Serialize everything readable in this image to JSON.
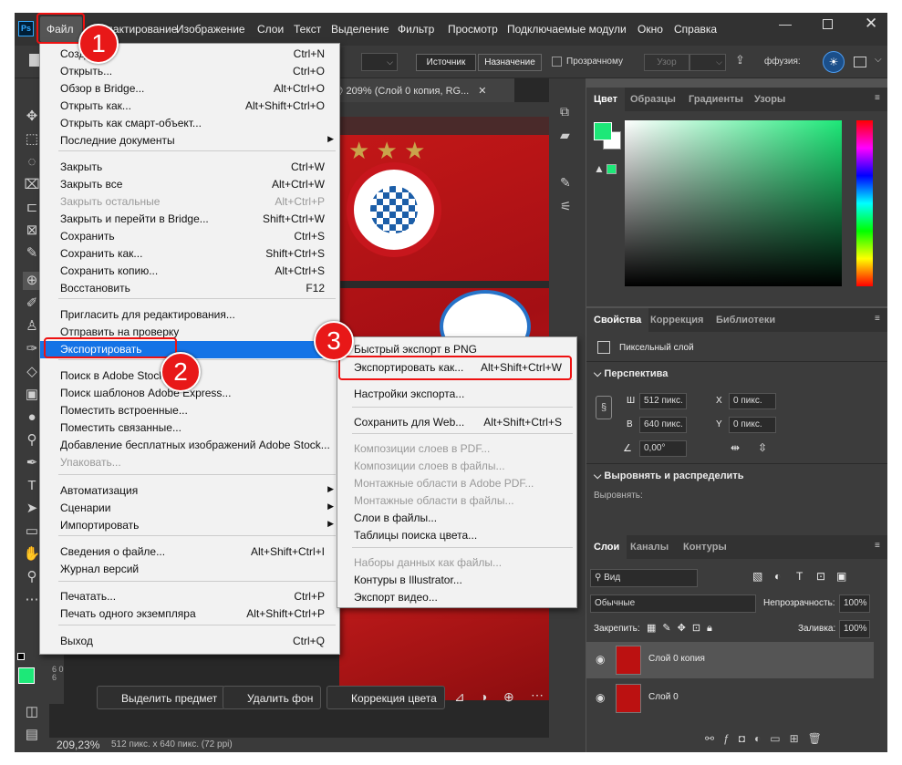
{
  "app": {
    "logo": "Ps"
  },
  "menubar": [
    "Файл",
    "Редактирование",
    "Изображение",
    "Слои",
    "Текст",
    "Выделение",
    "Фильтр",
    "Просмотр",
    "Подключаемые модули",
    "Окно",
    "Справка"
  ],
  "options": {
    "source": "Источник",
    "dest": "Назначение",
    "transparent": "Прозрачному",
    "pattern": "Узор",
    "zoom_field": "ффузия:"
  },
  "document": {
    "tab": "ng @ 209% (Слой 0 копия, RG...",
    "zoom": "209,23%",
    "info": "512 пикс. x 640 пикс. (72 ppi)",
    "ruler": "6 0 6"
  },
  "file_menu": {
    "items": [
      {
        "label": "Создать...",
        "shortcut": "Ctrl+N"
      },
      {
        "label": "Открыть...",
        "shortcut": "Ctrl+O"
      },
      {
        "label": "Обзор в Bridge...",
        "shortcut": "Alt+Ctrl+O"
      },
      {
        "label": "Открыть как...",
        "shortcut": "Alt+Shift+Ctrl+O"
      },
      {
        "label": "Открыть как смарт-объект...",
        "shortcut": ""
      },
      {
        "label": "Последние документы",
        "shortcut": ""
      },
      {
        "label": "Закрыть",
        "shortcut": "Ctrl+W"
      },
      {
        "label": "Закрыть все",
        "shortcut": "Alt+Ctrl+W"
      },
      {
        "label": "Закрыть остальные",
        "shortcut": "Alt+Ctrl+P"
      },
      {
        "label": "Закрыть и перейти в Bridge...",
        "shortcut": "Shift+Ctrl+W"
      },
      {
        "label": "Сохранить",
        "shortcut": "Ctrl+S"
      },
      {
        "label": "Сохранить как...",
        "shortcut": "Shift+Ctrl+S"
      },
      {
        "label": "Сохранить копию...",
        "shortcut": "Alt+Ctrl+S"
      },
      {
        "label": "Восстановить",
        "shortcut": "F12"
      },
      {
        "label": "Пригласить для редактирования...",
        "shortcut": ""
      },
      {
        "label": "Отправить на проверку",
        "shortcut": ""
      },
      {
        "label": "Экспортировать",
        "shortcut": ""
      },
      {
        "label": "Поиск в Adobe Stock...",
        "shortcut": ""
      },
      {
        "label": "Поиск шаблонов Adobe Express...",
        "shortcut": ""
      },
      {
        "label": "Поместить встроенные...",
        "shortcut": ""
      },
      {
        "label": "Поместить связанные...",
        "shortcut": ""
      },
      {
        "label": "Добавление бесплатных изображений Adobe Stock...",
        "shortcut": ""
      },
      {
        "label": "Упаковать...",
        "shortcut": ""
      },
      {
        "label": "Автоматизация",
        "shortcut": ""
      },
      {
        "label": "Сценарии",
        "shortcut": ""
      },
      {
        "label": "Импортировать",
        "shortcut": ""
      },
      {
        "label": "Сведения о файле...",
        "shortcut": "Alt+Shift+Ctrl+I"
      },
      {
        "label": "Журнал версий",
        "shortcut": ""
      },
      {
        "label": "Печатать...",
        "shortcut": "Ctrl+P"
      },
      {
        "label": "Печать одного экземпляра",
        "shortcut": "Alt+Shift+Ctrl+P"
      },
      {
        "label": "Выход",
        "shortcut": "Ctrl+Q"
      }
    ]
  },
  "export_menu": {
    "items": [
      {
        "label": "Быстрый экспорт в PNG",
        "shortcut": ""
      },
      {
        "label": "Экспортировать как...",
        "shortcut": "Alt+Shift+Ctrl+W"
      },
      {
        "label": "Настройки экспорта...",
        "shortcut": ""
      },
      {
        "label": "Сохранить для Web...",
        "shortcut": "Alt+Shift+Ctrl+S"
      },
      {
        "label": "Композиции слоев в PDF...",
        "shortcut": ""
      },
      {
        "label": "Композиции слоев в файлы...",
        "shortcut": ""
      },
      {
        "label": "Монтажные области в Adobe PDF...",
        "shortcut": ""
      },
      {
        "label": "Монтажные области в файлы...",
        "shortcut": ""
      },
      {
        "label": "Слои в файлы...",
        "shortcut": ""
      },
      {
        "label": "Таблицы поиска цвета...",
        "shortcut": ""
      },
      {
        "label": "Наборы данных как файлы...",
        "shortcut": ""
      },
      {
        "label": "Контуры в Illustrator...",
        "shortcut": ""
      },
      {
        "label": "Экспорт видео...",
        "shortcut": ""
      }
    ]
  },
  "badges": [
    "1",
    "2",
    "3"
  ],
  "color_panel": {
    "tabs": [
      "Цвет",
      "Образцы",
      "Градиенты",
      "Узоры"
    ],
    "fg": "#1de878"
  },
  "properties": {
    "tabs": [
      "Свойства",
      "Коррекция",
      "Библиотеки"
    ],
    "kind": "Пиксельный слой",
    "perspective": "Перспектива",
    "w_label": "Ш",
    "w": "512 пикс.",
    "h_label": "В",
    "h": "640 пикс.",
    "x_label": "X",
    "x": "0 пикс.",
    "y_label": "Y",
    "y": "0 пикс.",
    "angle": "0,00°",
    "align": "Выровнять и распределить",
    "align_sub": "Выровнять:"
  },
  "layers": {
    "tabs": [
      "Слои",
      "Каналы",
      "Контуры"
    ],
    "search": "Вид",
    "blend": "Обычные",
    "opacity_label": "Непрозрачность:",
    "opacity": "100%",
    "lock_label": "Закрепить:",
    "fill_label": "Заливка:",
    "fill": "100%",
    "items": [
      "Слой 0 копия",
      "Слой 0"
    ]
  },
  "contextbar": {
    "select": "Выделить предмет",
    "remove_bg": "Удалить фон",
    "color_corr": "Коррекция цвета"
  }
}
